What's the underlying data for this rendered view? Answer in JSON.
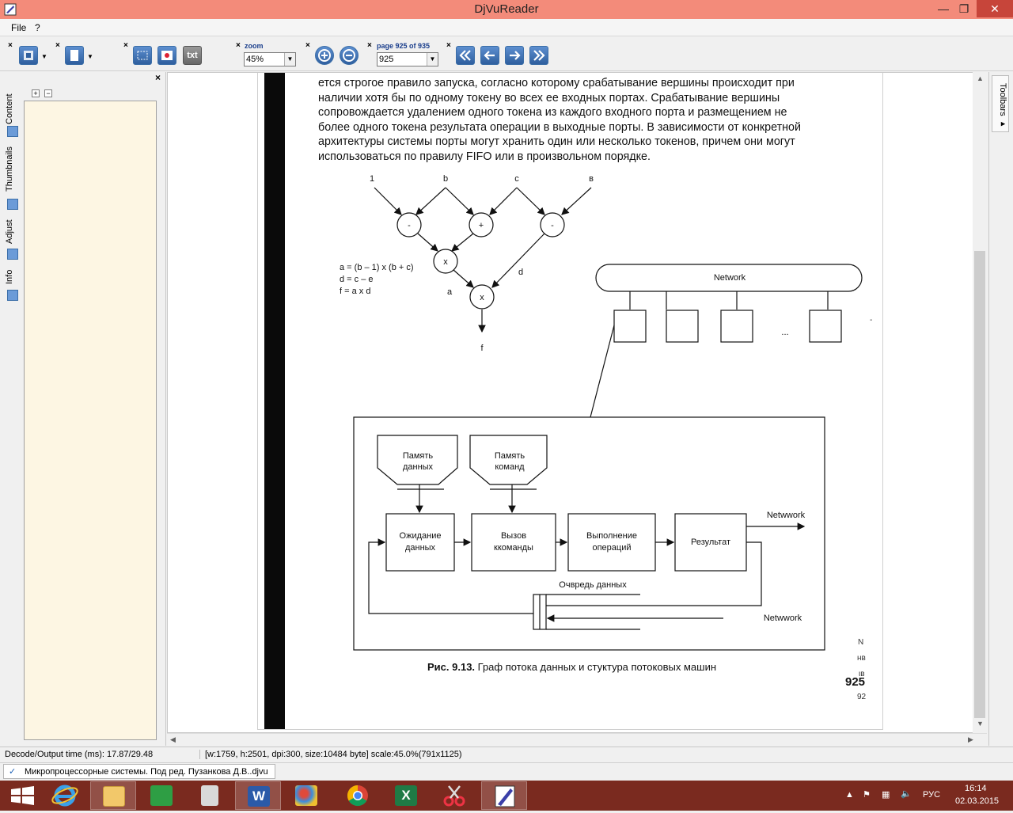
{
  "window": {
    "title": "DjVuReader",
    "min_glyph": "—",
    "max_glyph": "❐",
    "close_glyph": "✕"
  },
  "menu": {
    "file": "File",
    "help": "?"
  },
  "toolbar": {
    "close_glyph": "×",
    "txt_label": "txt",
    "zoom_label": "zoom",
    "zoom_value": "45%",
    "page_label": "page 925 of 935",
    "page_value": "925"
  },
  "sidebar": {
    "tabs": [
      "Content",
      "Thumbnails",
      "Adjust",
      "Info"
    ],
    "expand": "+",
    "collapse": "−",
    "close_glyph": "×"
  },
  "document": {
    "lines": [
      "ется строгое правило запуска, согласно которому срабатывание вершины происходит при",
      "наличии хотя бы по одному токену во всех ее входных портах. Срабатывание вершины",
      "сопровождается удалением одного токена из каждого входного порта и размещением не",
      "более одного токена результата операции в выходные порты. В зависимости от конкретной",
      "архитектуры системы порты могут хранить один или несколько токенов, причем они могут",
      "использоваться по правилу FIFO или в произвольном порядке."
    ],
    "graph": {
      "inputs": [
        "1",
        "b",
        "c",
        "в"
      ],
      "ops": [
        "-",
        "+",
        "-",
        "x",
        "x"
      ],
      "edge_labels": [
        "a",
        "d",
        "f"
      ],
      "equations": [
        "a = (b – 1) x (b + c)",
        "d = c – e",
        "f = a x d"
      ]
    },
    "machine": {
      "network_label": "Network",
      "dots": "...",
      "data_memory": [
        "Память",
        "данных"
      ],
      "cmd_memory": [
        "Память",
        "команд"
      ],
      "wait": [
        "Ожидание",
        "данных"
      ],
      "fetch": [
        "Вызов",
        "ккоманды"
      ],
      "exec": [
        "Выполнение",
        "операций"
      ],
      "result": "Результат",
      "out_network": "Netwwork",
      "queue": "Очвредь данных",
      "in_network": "Netwwork"
    },
    "caption_bold": "Рис. 9.13.",
    "caption_text": " Граф потока данных и стуктура потоковых машин",
    "page_number": "925",
    "margin_marks": [
      "N",
      "нв",
      "ιв",
      "92"
    ],
    "margin_dash": "-"
  },
  "right_panel": {
    "toolbars_label": "Toolbars ▸"
  },
  "status": {
    "decode": "Decode/Output time (ms): 17.87/29.48",
    "info": "[w:1759, h:2501, dpi:300, size:10484 byte] scale:45.0%(791x1125)"
  },
  "doc_tab": {
    "check": "✓",
    "name": "Микропроцессорные системы. Под ред. Пузанкова Д.В..djvu"
  },
  "taskbar": {
    "time": "16:14",
    "date": "02.03.2015",
    "lang": "РУС"
  },
  "colors": {
    "titlebar": "#f38b7a",
    "taskbar": "#7a2a1f",
    "content_bg": "#fdf6e3"
  }
}
